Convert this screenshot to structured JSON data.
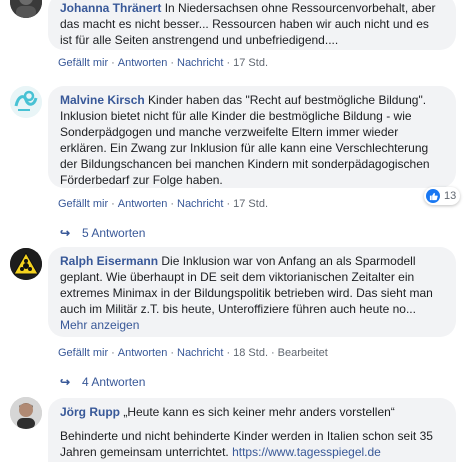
{
  "comments": [
    {
      "name": "Johanna Thränert",
      "text": " In Niedersachsen ohne Ressourcenvorbehalt, aber das macht es nicht besser... Ressourcen haben wir auch nicht und es ist für alle Seiten anstrengend und unbefriedigend....",
      "actions": {
        "like": "Gefällt mir",
        "reply": "Antworten",
        "message": "Nachricht",
        "time": "17 Std."
      }
    },
    {
      "name": "Malvine Kirsch",
      "text": " Kinder haben das \"Recht auf bestmögliche Bildung\". Inklusion bietet nicht für alle Kinder die bestmögliche Bildung - wie Sonderpädgogen und manche verzweifelte Eltern immer wieder erklären. Ein Zwang zur Inklusion für alle kann eine Verschlechterung der Bildungschancen bei manchen Kindern mit sonderpädagogischen Förderbedarf zur Folge haben.",
      "reaction_count": "13",
      "actions": {
        "like": "Gefällt mir",
        "reply": "Antworten",
        "message": "Nachricht",
        "time": "17 Std."
      },
      "replies": "5 Antworten"
    },
    {
      "name": "Ralph Eisermann",
      "text": " Die Inklusion war von Anfang an als Sparmodell geplant. Wie überhaupt in DE seit dem viktorianischen Zeitalter ein extremes Minimax in der Bildungspolitik betrieben wird. Das sieht man auch im Militär z.T. bis heute, Unteroffiziere führen auch heute no...",
      "more": " Mehr anzeigen",
      "actions": {
        "like": "Gefällt mir",
        "reply": "Antworten",
        "message": "Nachricht",
        "time": "18 Std.",
        "edited": "Bearbeitet"
      },
      "replies": "4 Antworten"
    },
    {
      "name": "Jörg Rupp",
      "text_line1": " „Heute kann es sich keiner mehr anders vorstellen“",
      "text_line2": "Behinderte und nicht behinderte Kinder werden in Italien schon seit 35 Jahren gemeinsam unterrichtet. ",
      "link": "https://www.tagesspiegel.de"
    }
  ],
  "colors": {
    "link": "#385898",
    "bubble": "#f2f3f5",
    "meta": "#606770",
    "like": "#1877f2"
  }
}
